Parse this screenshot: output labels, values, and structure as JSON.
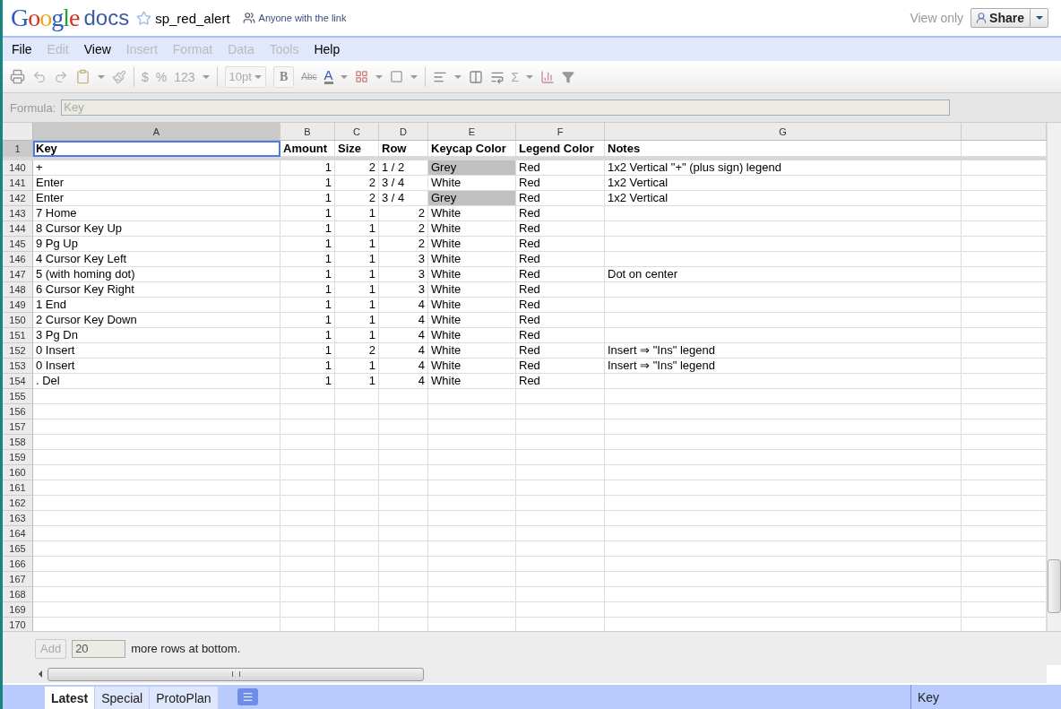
{
  "header": {
    "logo": "Google",
    "product": "docs",
    "title": "sp_red_alert",
    "sharing": "Anyone with the link",
    "mode": "View only",
    "share_button": "Share"
  },
  "menu": [
    {
      "label": "File",
      "disabled": false
    },
    {
      "label": "Edit",
      "disabled": true
    },
    {
      "label": "View",
      "disabled": false
    },
    {
      "label": "Insert",
      "disabled": true
    },
    {
      "label": "Format",
      "disabled": true
    },
    {
      "label": "Data",
      "disabled": true
    },
    {
      "label": "Tools",
      "disabled": true
    },
    {
      "label": "Help",
      "disabled": false
    }
  ],
  "toolbar": {
    "currency": "$",
    "percent": "%",
    "number_format": "123",
    "font_size": "10pt",
    "bold": "B",
    "strikethrough": "Abc",
    "text_color": "A",
    "sum": "Σ"
  },
  "formula_bar": {
    "label": "Formula:",
    "value": "Key"
  },
  "columns": [
    {
      "label": "A",
      "selected": true
    },
    {
      "label": "B",
      "selected": false
    },
    {
      "label": "C",
      "selected": false
    },
    {
      "label": "D",
      "selected": false
    },
    {
      "label": "E",
      "selected": false
    },
    {
      "label": "F",
      "selected": false
    },
    {
      "label": "G",
      "selected": false
    }
  ],
  "header_row": {
    "number": "1",
    "selected": true,
    "cells": [
      "Key",
      "Amount",
      "Size",
      "Row",
      "Keycap Color",
      "Legend Color",
      "Notes"
    ]
  },
  "rows": [
    {
      "number": "140",
      "shaded": true,
      "cells": [
        "+",
        "1",
        "2",
        "1 / 2",
        "Grey",
        "Red",
        "1x2 Vertical \"+\" (plus sign) legend"
      ]
    },
    {
      "number": "141",
      "shaded": false,
      "cells": [
        "Enter",
        "1",
        "2",
        "3 / 4",
        "White",
        "Red",
        "1x2 Vertical"
      ]
    },
    {
      "number": "142",
      "shaded": true,
      "cells": [
        "Enter",
        "1",
        "2",
        "3 / 4",
        "Grey",
        "Red",
        "1x2 Vertical"
      ]
    },
    {
      "number": "143",
      "shaded": false,
      "cells": [
        "7 Home",
        "1",
        "1",
        "2",
        "White",
        "Red"
      ]
    },
    {
      "number": "144",
      "shaded": false,
      "cells": [
        "8 Cursor Key Up",
        "1",
        "1",
        "2",
        "White",
        "Red"
      ]
    },
    {
      "number": "145",
      "shaded": false,
      "cells": [
        "9 Pg Up",
        "1",
        "1",
        "2",
        "White",
        "Red"
      ]
    },
    {
      "number": "146",
      "shaded": false,
      "cells": [
        "4 Cursor Key Left",
        "1",
        "1",
        "3",
        "White",
        "Red"
      ]
    },
    {
      "number": "147",
      "shaded": false,
      "cells": [
        "5 (with homing dot)",
        "1",
        "1",
        "3",
        "White",
        "Red",
        "Dot on center"
      ]
    },
    {
      "number": "148",
      "shaded": false,
      "cells": [
        "6 Cursor Key Right",
        "1",
        "1",
        "3",
        "White",
        "Red"
      ]
    },
    {
      "number": "149",
      "shaded": false,
      "cells": [
        "1 End",
        "1",
        "1",
        "4",
        "White",
        "Red"
      ]
    },
    {
      "number": "150",
      "shaded": false,
      "cells": [
        "2 Cursor Key Down",
        "1",
        "1",
        "4",
        "White",
        "Red"
      ]
    },
    {
      "number": "151",
      "shaded": false,
      "cells": [
        "3 Pg Dn",
        "1",
        "1",
        "4",
        "White",
        "Red"
      ]
    },
    {
      "number": "152",
      "shaded": false,
      "cells": [
        "0 Insert",
        "1",
        "2",
        "4",
        "White",
        "Red",
        "Insert ⇒ \"Ins\" legend"
      ]
    },
    {
      "number": "153",
      "shaded": false,
      "cells": [
        "0 Insert",
        "1",
        "1",
        "4",
        "White",
        "Red",
        "Insert ⇒ \"Ins\" legend"
      ]
    },
    {
      "number": "154",
      "shaded": false,
      "cells": [
        ". Del",
        "1",
        "1",
        "4",
        "White",
        "Red"
      ]
    }
  ],
  "empty_rows": [
    "155",
    "156",
    "157",
    "158",
    "159",
    "160",
    "161",
    "162",
    "163",
    "164",
    "165",
    "166",
    "167",
    "168",
    "169",
    "170"
  ],
  "add_rows": {
    "button": "Add",
    "disabled": true,
    "value": "20",
    "text": "more rows at bottom."
  },
  "sheets": [
    {
      "label": "Latest",
      "selected": true
    },
    {
      "label": "Special",
      "selected": false
    },
    {
      "label": "ProtoPlan",
      "selected": false
    }
  ],
  "status": "Key"
}
